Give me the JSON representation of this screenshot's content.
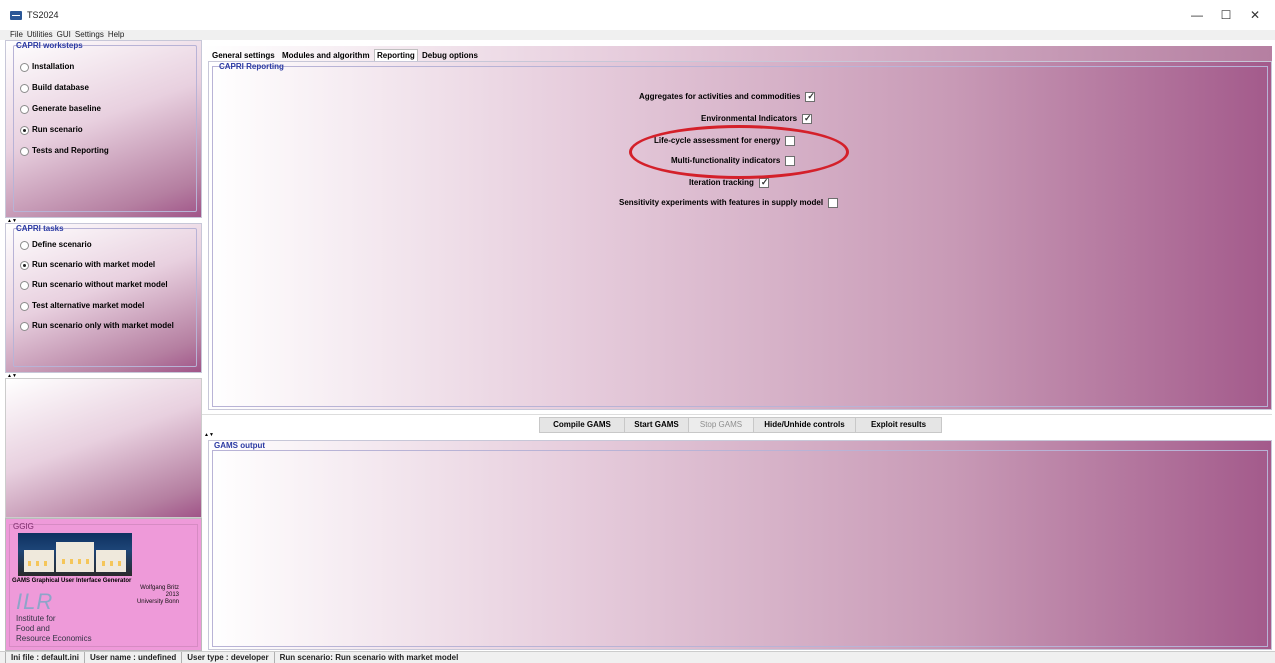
{
  "window": {
    "title": "TS2024",
    "controls": {
      "minimize": "—",
      "maximize": "☐",
      "close": "✕"
    }
  },
  "menu": [
    "File",
    "Utilities",
    "GUI",
    "Settings",
    "Help"
  ],
  "worksteps": {
    "title": "CAPRI worksteps",
    "items": [
      {
        "label": "Installation",
        "selected": false
      },
      {
        "label": "Build database",
        "selected": false
      },
      {
        "label": "Generate baseline",
        "selected": false
      },
      {
        "label": "Run scenario",
        "selected": true
      },
      {
        "label": "Tests and Reporting",
        "selected": false
      }
    ]
  },
  "tasks": {
    "title": "CAPRI tasks",
    "items": [
      {
        "label": "Define scenario",
        "selected": false
      },
      {
        "label": "Run scenario with market model",
        "selected": true
      },
      {
        "label": "Run scenario without market model",
        "selected": false
      },
      {
        "label": "Test alternative market model",
        "selected": false
      },
      {
        "label": "Run scenario only with market model",
        "selected": false
      }
    ]
  },
  "logo": {
    "title": "GGIG",
    "caption": "GAMS Graphical User Interface Generator",
    "author": "Wolfgang Britz",
    "year": "2013",
    "university": "University Bonn",
    "ilr": "ILR",
    "institute_line1": "Institute  for",
    "institute_line2": "Food and",
    "institute_line3": "Resource Economics"
  },
  "tabs": [
    {
      "label": "General settings",
      "active": false
    },
    {
      "label": "Modules and algorithm",
      "active": false
    },
    {
      "label": "Reporting",
      "active": true
    },
    {
      "label": "Debug options",
      "active": false
    }
  ],
  "reporting": {
    "title": "CAPRI Reporting",
    "options": [
      {
        "label": "Aggregates for activities and commodities",
        "checked": true
      },
      {
        "label": "Environmental Indicators",
        "checked": true
      },
      {
        "label": "Life-cycle assessment for energy",
        "checked": false
      },
      {
        "label": "Multi-functionality indicators",
        "checked": false
      },
      {
        "label": "Iteration tracking",
        "checked": true
      },
      {
        "label": "Sensitivity experiments with features in supply model",
        "checked": false
      }
    ]
  },
  "buttons": {
    "compile": "Compile GAMS",
    "start": "Start GAMS",
    "stop": "Stop GAMS",
    "hide": "Hide/Unhide controls",
    "exploit": "Exploit results"
  },
  "gams_output": {
    "title": "GAMS output"
  },
  "status": {
    "ini": "Ini file : default.ini",
    "user": "User name : undefined",
    "type": "User type : developer",
    "task": "Run scenario: Run scenario with market model"
  },
  "colors": {
    "gradient_end": "#a35a8b",
    "title_blue": "#2b3aa3",
    "highlight_red": "#d4202a",
    "logo_pink": "#ee9ad9"
  }
}
